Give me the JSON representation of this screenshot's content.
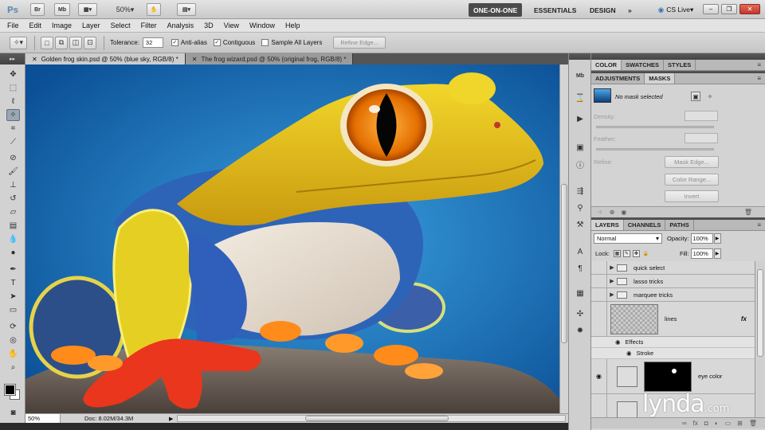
{
  "appbar": {
    "logo": "Ps",
    "btn_bridge": "Br",
    "btn_minibridge": "Mb",
    "zoom": "50%",
    "workspaces": [
      "ONE-ON-ONE",
      "ESSENTIALS",
      "DESIGN"
    ],
    "more": "»",
    "cslive": "CS Live"
  },
  "menu": [
    "File",
    "Edit",
    "Image",
    "Layer",
    "Select",
    "Filter",
    "Analysis",
    "3D",
    "View",
    "Window",
    "Help"
  ],
  "options": {
    "tolerance_label": "Tolerance:",
    "tolerance_value": "32",
    "antialias_label": "Anti-alias",
    "contiguous_label": "Contiguous",
    "sample_all_label": "Sample All Layers",
    "refine_edge": "Refine Edge..."
  },
  "doc_tabs": [
    "Golden frog skin.psd @ 50% (blue sky, RGB/8) *",
    "The frog wizard.psd @ 50% (original frog, RGB/8) *"
  ],
  "status": {
    "zoom": "50%",
    "doc": "Doc: 8.02M/34.3M"
  },
  "panel_top": {
    "tabs": [
      "COLOR",
      "SWATCHES",
      "STYLES"
    ]
  },
  "masks": {
    "tabs": [
      "ADJUSTMENTS",
      "MASKS"
    ],
    "no_mask": "No mask selected",
    "density": "Density:",
    "feather": "Feather:",
    "refine": "Refine:",
    "mask_edge": "Mask Edge...",
    "color_range": "Color Range...",
    "invert": "Invert"
  },
  "layers": {
    "tabs": [
      "LAYERS",
      "CHANNELS",
      "PATHS"
    ],
    "blend_mode": "Normal",
    "opacity_label": "Opacity:",
    "opacity_value": "100%",
    "lock_label": "Lock:",
    "fill_label": "Fill:",
    "fill_value": "100%",
    "groups": [
      "quick select",
      "lasso tricks",
      "marquee tricks"
    ],
    "lines_layer": "lines",
    "effects": "Effects",
    "stroke": "Stroke",
    "eye_color": "eye color"
  },
  "watermark": {
    "name": "lynda",
    "suffix": ".com"
  },
  "colors": {
    "sky": "#1b75b8",
    "frog_yellow": "#e9c81a",
    "toes": "#ff8c1a"
  }
}
